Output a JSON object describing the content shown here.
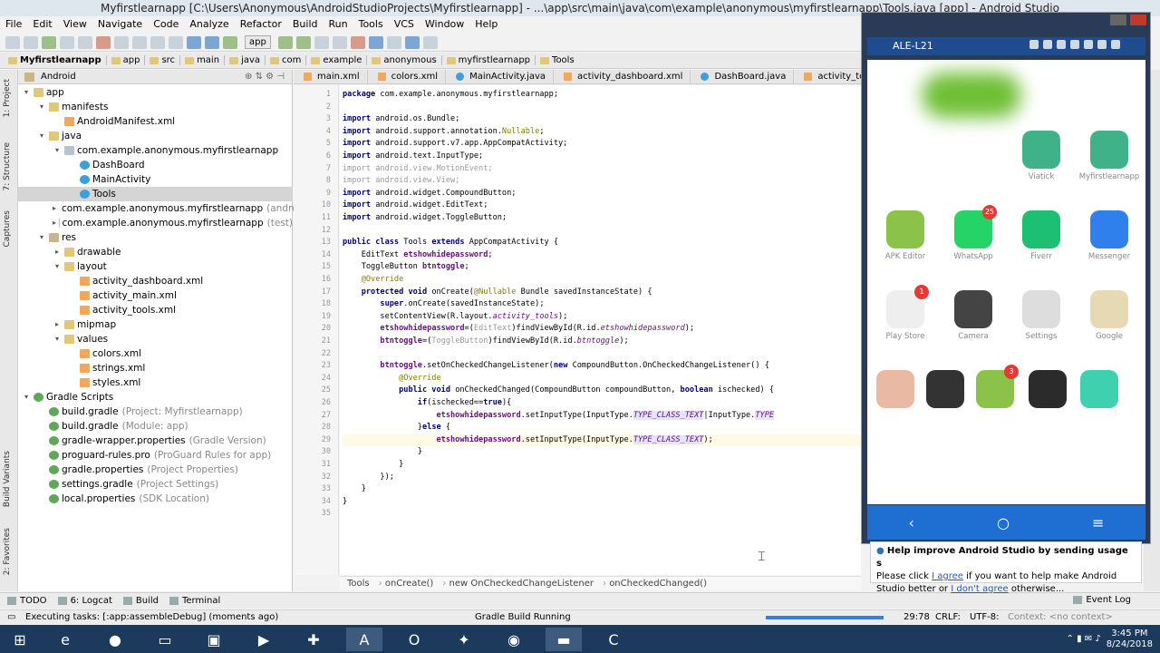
{
  "window": {
    "title": "Myfirstlearnapp [C:\\Users\\Anonymous\\AndroidStudioProjects\\Myfirstlearnapp] - ...\\app\\src\\main\\java\\com\\example\\anonymous\\myfirstlearnapp\\Tools.java [app] - Android Studio"
  },
  "menu": [
    "File",
    "Edit",
    "View",
    "Navigate",
    "Code",
    "Analyze",
    "Refactor",
    "Build",
    "Run",
    "Tools",
    "VCS",
    "Window",
    "Help"
  ],
  "toolbar": {
    "config": "app"
  },
  "breadcrumb": [
    "Myfirstlearnapp",
    "app",
    "src",
    "main",
    "java",
    "com",
    "example",
    "anonymous",
    "myfirstlearnapp",
    "Tools"
  ],
  "project_panel": {
    "view": "Android",
    "tree": [
      {
        "depth": 0,
        "arrow": "▾",
        "icon": "fold",
        "label": "app",
        "hint": ""
      },
      {
        "depth": 1,
        "arrow": "▾",
        "icon": "fold",
        "label": "manifests",
        "hint": ""
      },
      {
        "depth": 2,
        "arrow": "",
        "icon": "xml",
        "label": "AndroidManifest.xml",
        "hint": ""
      },
      {
        "depth": 1,
        "arrow": "▾",
        "icon": "fold",
        "label": "java",
        "hint": ""
      },
      {
        "depth": 2,
        "arrow": "▾",
        "icon": "pkg",
        "label": "com.example.anonymous.myfirstlearnapp",
        "hint": ""
      },
      {
        "depth": 3,
        "arrow": "",
        "icon": "cls",
        "label": "DashBoard",
        "hint": ""
      },
      {
        "depth": 3,
        "arrow": "",
        "icon": "cls",
        "label": "MainActivity",
        "hint": ""
      },
      {
        "depth": 3,
        "arrow": "",
        "icon": "cls",
        "label": "Tools",
        "hint": "",
        "selected": true
      },
      {
        "depth": 2,
        "arrow": "▸",
        "icon": "pkg",
        "label": "com.example.anonymous.myfirstlearnapp",
        "hint": "(andro"
      },
      {
        "depth": 2,
        "arrow": "▸",
        "icon": "pkg",
        "label": "com.example.anonymous.myfirstlearnapp",
        "hint": "(test)"
      },
      {
        "depth": 1,
        "arrow": "▾",
        "icon": "res",
        "label": "res",
        "hint": ""
      },
      {
        "depth": 2,
        "arrow": "▸",
        "icon": "fold",
        "label": "drawable",
        "hint": ""
      },
      {
        "depth": 2,
        "arrow": "▾",
        "icon": "fold",
        "label": "layout",
        "hint": ""
      },
      {
        "depth": 3,
        "arrow": "",
        "icon": "xml",
        "label": "activity_dashboard.xml",
        "hint": ""
      },
      {
        "depth": 3,
        "arrow": "",
        "icon": "xml",
        "label": "activity_main.xml",
        "hint": ""
      },
      {
        "depth": 3,
        "arrow": "",
        "icon": "xml",
        "label": "activity_tools.xml",
        "hint": ""
      },
      {
        "depth": 2,
        "arrow": "▸",
        "icon": "fold",
        "label": "mipmap",
        "hint": ""
      },
      {
        "depth": 2,
        "arrow": "▾",
        "icon": "fold",
        "label": "values",
        "hint": ""
      },
      {
        "depth": 3,
        "arrow": "",
        "icon": "xml",
        "label": "colors.xml",
        "hint": ""
      },
      {
        "depth": 3,
        "arrow": "",
        "icon": "xml",
        "label": "strings.xml",
        "hint": ""
      },
      {
        "depth": 3,
        "arrow": "",
        "icon": "xml",
        "label": "styles.xml",
        "hint": ""
      },
      {
        "depth": 0,
        "arrow": "▾",
        "icon": "grd",
        "label": "Gradle Scripts",
        "hint": ""
      },
      {
        "depth": 1,
        "arrow": "",
        "icon": "grd",
        "label": "build.gradle",
        "hint": "(Project: Myfirstlearnapp)"
      },
      {
        "depth": 1,
        "arrow": "",
        "icon": "grd",
        "label": "build.gradle",
        "hint": "(Module: app)"
      },
      {
        "depth": 1,
        "arrow": "",
        "icon": "grd",
        "label": "gradle-wrapper.properties",
        "hint": "(Gradle Version)"
      },
      {
        "depth": 1,
        "arrow": "",
        "icon": "grd",
        "label": "proguard-rules.pro",
        "hint": "(ProGuard Rules for app)"
      },
      {
        "depth": 1,
        "arrow": "",
        "icon": "grd",
        "label": "gradle.properties",
        "hint": "(Project Properties)"
      },
      {
        "depth": 1,
        "arrow": "",
        "icon": "grd",
        "label": "settings.gradle",
        "hint": "(Project Settings)"
      },
      {
        "depth": 1,
        "arrow": "",
        "icon": "grd",
        "label": "local.properties",
        "hint": "(SDK Location)"
      }
    ]
  },
  "left_strip_tabs": [
    "1: Project",
    "7: Structure",
    "Captures",
    "Build Variants",
    "2: Favorites"
  ],
  "editor_tabs": [
    "main.xml",
    "colors.xml",
    "MainActivity.java",
    "activity_dashboard.xml",
    "DashBoard.java",
    "activity_too"
  ],
  "code_lines": [
    {
      "n": "1",
      "html": "<span class=\"kw\">package</span> com.example.anonymous.myfirstlearnapp;"
    },
    {
      "n": "2",
      "html": ""
    },
    {
      "n": "3",
      "html": "<span class=\"kw\">import</span> android.os.Bundle;"
    },
    {
      "n": "4",
      "html": "<span class=\"kw\">import</span> android.support.annotation.<span class=\"ann\">Nullable</span>;"
    },
    {
      "n": "5",
      "html": "<span class=\"kw\">import</span> android.support.v7.app.AppCompatActivity;"
    },
    {
      "n": "6",
      "html": "<span class=\"kw\">import</span> android.text.InputType;"
    },
    {
      "n": "7",
      "html": "<span class=\"grey\">import android.view.MotionEvent;</span>"
    },
    {
      "n": "8",
      "html": "<span class=\"grey\">import android.view.View;</span>"
    },
    {
      "n": "9",
      "html": "<span class=\"kw\">import</span> android.widget.CompoundButton;"
    },
    {
      "n": "10",
      "html": "<span class=\"kw\">import</span> android.widget.EditText;"
    },
    {
      "n": "11",
      "html": "<span class=\"kw\">import</span> android.widget.ToggleButton;"
    },
    {
      "n": "12",
      "html": ""
    },
    {
      "n": "13",
      "html": "<span class=\"kw\">public class</span> Tools <span class=\"kw\">extends</span> AppCompatActivity {"
    },
    {
      "n": "14",
      "html": "    EditText <span class=\"fld\">etshowhidepassword</span>;"
    },
    {
      "n": "15",
      "html": "    ToggleButton <span class=\"fld\">btntoggle</span>;"
    },
    {
      "n": "16",
      "html": "    <span class=\"ann\">@Override</span>"
    },
    {
      "n": "17",
      "html": "    <span class=\"kw\">protected void</span> onCreate(<span class=\"ann\">@Nullable</span> Bundle savedInstanceState) {"
    },
    {
      "n": "18",
      "html": "        <span class=\"kw\">super</span>.onCreate(savedInstanceState);"
    },
    {
      "n": "19",
      "html": "        setContentView(R.layout.<span class=\"fldi\">activity_tools</span>);"
    },
    {
      "n": "20",
      "html": "        <span class=\"fld\">etshowhidepassword</span>=(<span class=\"grey\">EditText</span>)findViewById(R.id.<span class=\"fldi\">etshowhidepassword</span>);"
    },
    {
      "n": "21",
      "html": "        <span class=\"fld\">btntoggle</span>=(<span class=\"grey\">ToggleButton</span>)findViewById(R.id.<span class=\"fldi\">btntoggle</span>);"
    },
    {
      "n": "22",
      "html": ""
    },
    {
      "n": "23",
      "html": "        <span class=\"fld\">btntoggle</span>.setOnCheckedChangeListener(<span class=\"kw\">new</span> CompoundButton.OnCheckedChangeListener() {"
    },
    {
      "n": "24",
      "html": "            <span class=\"ann\">@Override</span>"
    },
    {
      "n": "25",
      "html": "            <span class=\"kw\">public void</span> onCheckedChanged(CompoundButton compoundButton, <span class=\"kw\">boolean</span> ischecked) {"
    },
    {
      "n": "26",
      "html": "                <span class=\"kw\">if</span>(ischecked==<span class=\"kw\">true</span>){"
    },
    {
      "n": "27",
      "html": "                    <span class=\"fld\">etshowhidepassword</span>.setInputType(InputType.<span class=\"sf\">TYPE_CLASS_TEXT</span>|InputType.<span class=\"sf\">TYPE</span>"
    },
    {
      "n": "28",
      "html": "                }<span class=\"kw\">else</span> {"
    },
    {
      "n": "29",
      "html": "                    <span class=\"fld\">etshowhidepassword</span>.setInputType(InputType.<span class=\"sf\">TYPE_CLASS_TEXT</span>);",
      "current": true
    },
    {
      "n": "30",
      "html": "                }"
    },
    {
      "n": "31",
      "html": "            }"
    },
    {
      "n": "32",
      "html": "        });"
    },
    {
      "n": "33",
      "html": "    }"
    },
    {
      "n": "34",
      "html": "}"
    },
    {
      "n": "35",
      "html": ""
    }
  ],
  "code_breadcrumb": [
    "Tools",
    "onCreate()",
    "new OnCheckedChangeListener",
    "onCheckedChanged()"
  ],
  "bottom_tools": [
    "TODO",
    "6: Logcat",
    "Build",
    "Terminal"
  ],
  "event_log": "Event Log",
  "status": {
    "message": "Executing tasks: [:app:assembleDebug] (moments ago)",
    "gradle": "Gradle Build Running",
    "progress": 1.0,
    "position": "29:78",
    "line_sep": "CRLF:",
    "encoding": "UTF-8:",
    "context": "Context: <no context>"
  },
  "phone": {
    "device": "ALE-L21",
    "apps": [
      {
        "label": "Viatick",
        "color": "#3fb28a",
        "badge": ""
      },
      {
        "label": "Myfirstlearnapp",
        "color": "#3fb28a",
        "badge": ""
      },
      {
        "label": "APK Editor",
        "color": "#8bc34a",
        "badge": ""
      },
      {
        "label": "WhatsApp",
        "color": "#25d366",
        "badge": "25"
      },
      {
        "label": "Fiverr",
        "color": "#1dbf73",
        "badge": ""
      },
      {
        "label": "Messenger",
        "color": "#2f80ed",
        "badge": ""
      },
      {
        "label": "Play Store",
        "color": "#eeeeee",
        "badge": "1"
      },
      {
        "label": "Camera",
        "color": "#444444",
        "badge": ""
      },
      {
        "label": "Settings",
        "color": "#dddddd",
        "badge": ""
      },
      {
        "label": "Google",
        "color": "#e8d9b5",
        "badge": ""
      },
      {
        "label": "",
        "color": "#e9b9a3",
        "badge": ""
      },
      {
        "label": "",
        "color": "#333333",
        "badge": ""
      },
      {
        "label": "",
        "color": "#8bc34a",
        "badge": "3"
      },
      {
        "label": "",
        "color": "#2b2b2b",
        "badge": ""
      },
      {
        "label": "",
        "color": "#3fd0b0",
        "badge": ""
      }
    ],
    "nav": [
      "‹",
      "○",
      "≡"
    ]
  },
  "notification": {
    "title": "Help improve Android Studio by sending usage s",
    "text_pre": "Please click ",
    "agree": "I agree",
    "text_mid": " if you want to help make Android Studio better or ",
    "disagree": "I don't agree",
    "text_post": " otherwise..."
  },
  "taskbar": {
    "time": "3:45 PM",
    "date": "8/24/2018"
  }
}
